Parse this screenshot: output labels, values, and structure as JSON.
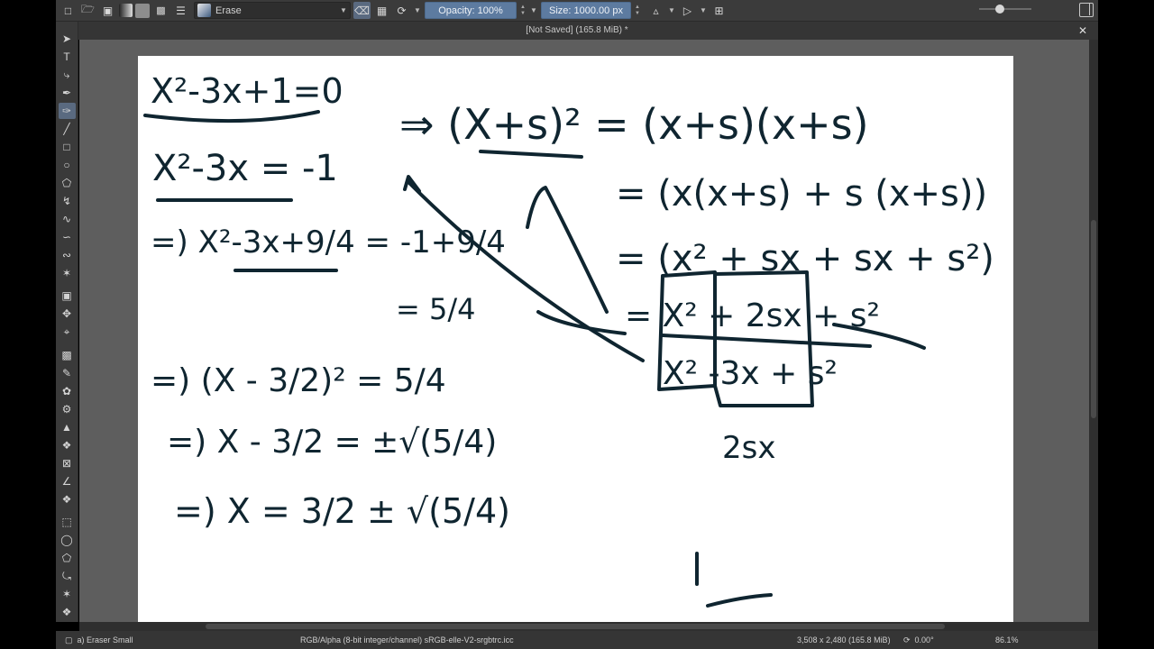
{
  "toolbar": {
    "brush_preset": "Erase",
    "opacity": "Opacity: 100%",
    "size": "Size: 1000.00 px",
    "fg_color": "#555555",
    "bg_color": "#9a9a9a"
  },
  "document": {
    "title": "[Not Saved]  (165.8 MiB) *"
  },
  "status": {
    "brush": "a) Eraser Small",
    "color_profile": "RGB/Alpha (8-bit integer/channel)  sRGB-elle-V2-srgbtrc.icc",
    "image_size": "3,508 x 2,480 (165.8 MiB)",
    "rotation": "0.00°",
    "zoom": "86.1%"
  },
  "canvas": {
    "eq1": "X²-3x+1=0",
    "eq2": "X²-3x = -1",
    "eq3": "=) X²-3x+9/4 = -1+9/4",
    "eq4": "= 5/4",
    "eq5": "=) (X - 3/2)² = 5/4",
    "eq6": "=) X - 3/2 = ±√(5/4)",
    "eq7": "=) X = 3/2 ± √(5/4)",
    "r1": "⇒ (X+s)² = (x+s)(x+s)",
    "r2": "= (x(x+s) + s (x+s))",
    "r3": "= (x² + sx + sx + s²)",
    "r4": "= X² + 2sx + s²",
    "r5": "X² -3x + s²",
    "r6": "2sx"
  }
}
